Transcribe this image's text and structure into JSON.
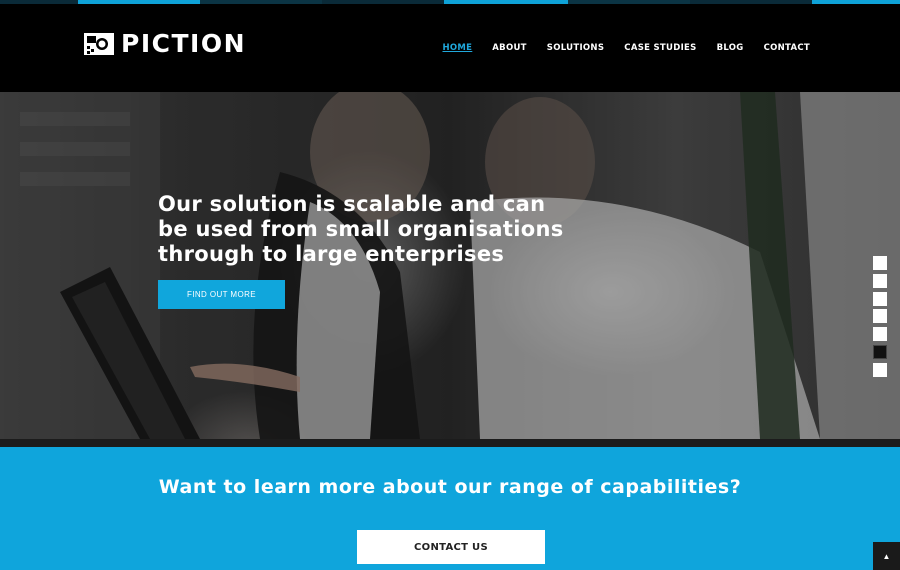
{
  "brand": {
    "name": "PICTION",
    "accent_color": "#0fa5dc"
  },
  "nav": {
    "items": [
      {
        "label": "HOME",
        "active": true
      },
      {
        "label": "ABOUT",
        "active": false
      },
      {
        "label": "SOLUTIONS",
        "active": false
      },
      {
        "label": "CASE STUDIES",
        "active": false
      },
      {
        "label": "BLOG",
        "active": false
      },
      {
        "label": "CONTACT",
        "active": false
      }
    ]
  },
  "hero": {
    "headline_line1": "Our solution is scalable and can",
    "headline_line2": "be used from small organisations",
    "headline_line3": "through to large enterprises",
    "cta_label": "FIND OUT MORE",
    "slide_count": 7,
    "active_slide_index": 5
  },
  "capabilities": {
    "heading": "Want to learn more about our range of capabilities?",
    "button_label": "CONTACT US"
  },
  "back_to_top": {
    "icon": "caret-up-icon",
    "glyph": "▲"
  }
}
